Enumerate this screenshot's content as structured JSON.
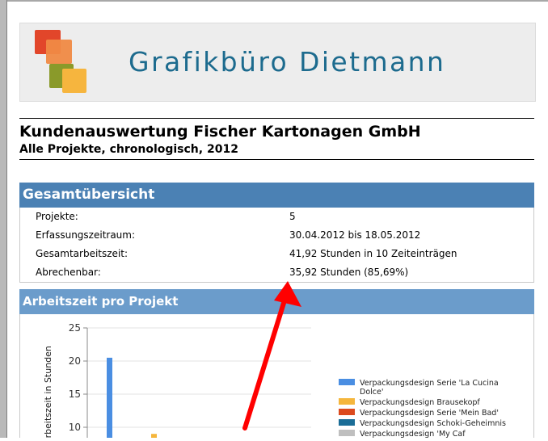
{
  "logo": {
    "brand_name": "Grafikbüro Dietmann"
  },
  "report": {
    "title": "Kundenauswertung Fischer Kartonagen GmbH",
    "subtitle": "Alle Projekte, chronologisch, 2012"
  },
  "summary": {
    "heading": "Gesamtübersicht",
    "rows": [
      {
        "label": "Projekte:",
        "value": "5"
      },
      {
        "label": "Erfassungszeitraum:",
        "value": "30.04.2012 bis 18.05.2012"
      },
      {
        "label": "Gesamtarbeitszeit:",
        "value": "41,92 Stunden in 10 Zeiteinträgen"
      },
      {
        "label": "Abrechenbar:",
        "value": "35,92 Stunden (85,69%)"
      }
    ]
  },
  "chart_section": {
    "heading": "Arbeitszeit pro Projekt"
  },
  "chart_data": {
    "type": "bar",
    "ylabel": "Arbeitszeit in Stunden",
    "ylim": [
      0,
      25
    ],
    "yticks": [
      "25",
      "20",
      "15",
      "10"
    ],
    "grid": true,
    "legend_position": "right",
    "series": [
      {
        "name": "Verpackungsdesign Serie 'La Cucina Dolce'",
        "color": "#4a8ee2",
        "value": 20.5
      },
      {
        "name": "Verpackungsdesign Brausekopf",
        "color": "#f5b63c",
        "value": 9.0
      },
      {
        "name": "Verpackungsdesign Serie 'Mein Bad'",
        "color": "#dc4a1e",
        "value": null
      },
      {
        "name": "Verpackungsdesign Schoki-Geheimnis",
        "color": "#1b6d97",
        "value": null
      },
      {
        "name": "Verpackungsdesign 'My Caf",
        "color": "#bfbfbf",
        "value": null
      }
    ]
  },
  "annotation": {
    "arrow_color": "#ff0000"
  }
}
